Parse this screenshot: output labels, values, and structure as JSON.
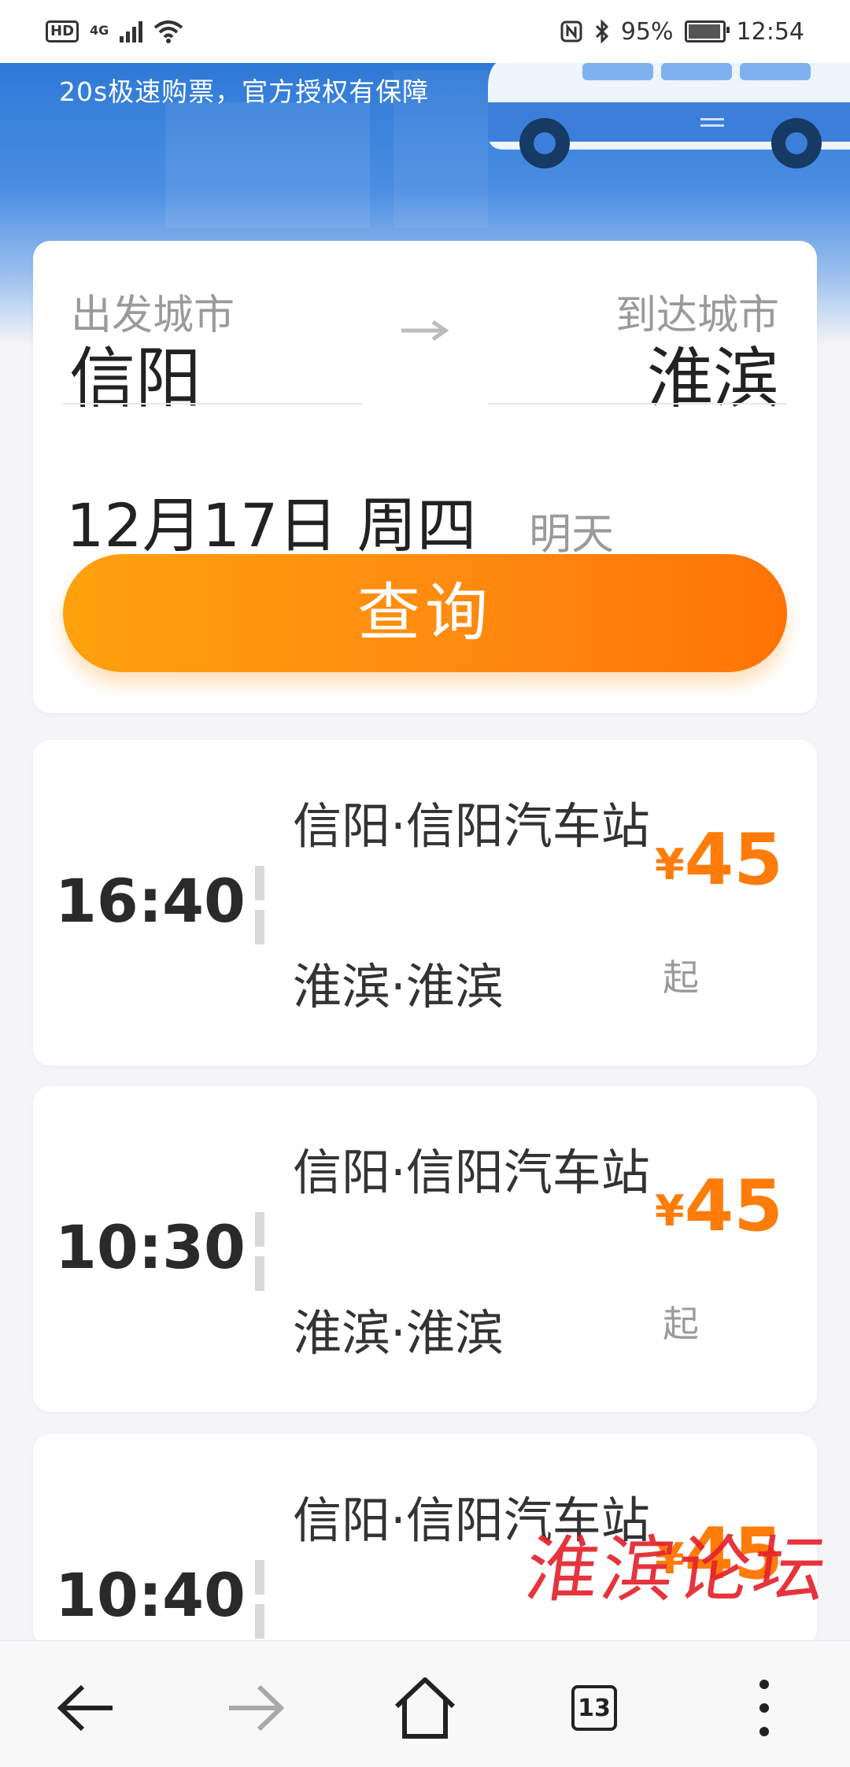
{
  "status_bar": {
    "hd": "HD",
    "network": "4G",
    "battery_percent": "95%",
    "time": "12:54"
  },
  "banner": {
    "slogan": "20s极速购票，官方授权有保障"
  },
  "search": {
    "from_label": "出发城市",
    "from_city": "信阳",
    "to_label": "到达城市",
    "to_city": "淮滨",
    "date": "12月17日 周四",
    "date_hint": "明天",
    "button_label": "查询"
  },
  "trips": [
    {
      "time": "16:40",
      "departure": "信阳·信阳汽车站",
      "arrival": "淮滨·淮滨",
      "price": "45",
      "currency": "¥",
      "price_suffix": "起"
    },
    {
      "time": "10:30",
      "departure": "信阳·信阳汽车站",
      "arrival": "淮滨·淮滨",
      "price": "45",
      "currency": "¥",
      "price_suffix": "起"
    },
    {
      "time": "10:40",
      "departure": "信阳·信阳汽车站",
      "arrival": "",
      "price": "45",
      "currency": "¥",
      "price_suffix": ""
    }
  ],
  "watermark": "淮滨论坛",
  "bottom_nav": {
    "tab_count": "13",
    "icons": [
      "back-arrow-icon",
      "forward-arrow-icon",
      "home-icon",
      "tabs-icon",
      "more-icon"
    ]
  },
  "colors": {
    "accent_orange": "#ff7c0a",
    "banner_blue": "#2e79d6"
  }
}
